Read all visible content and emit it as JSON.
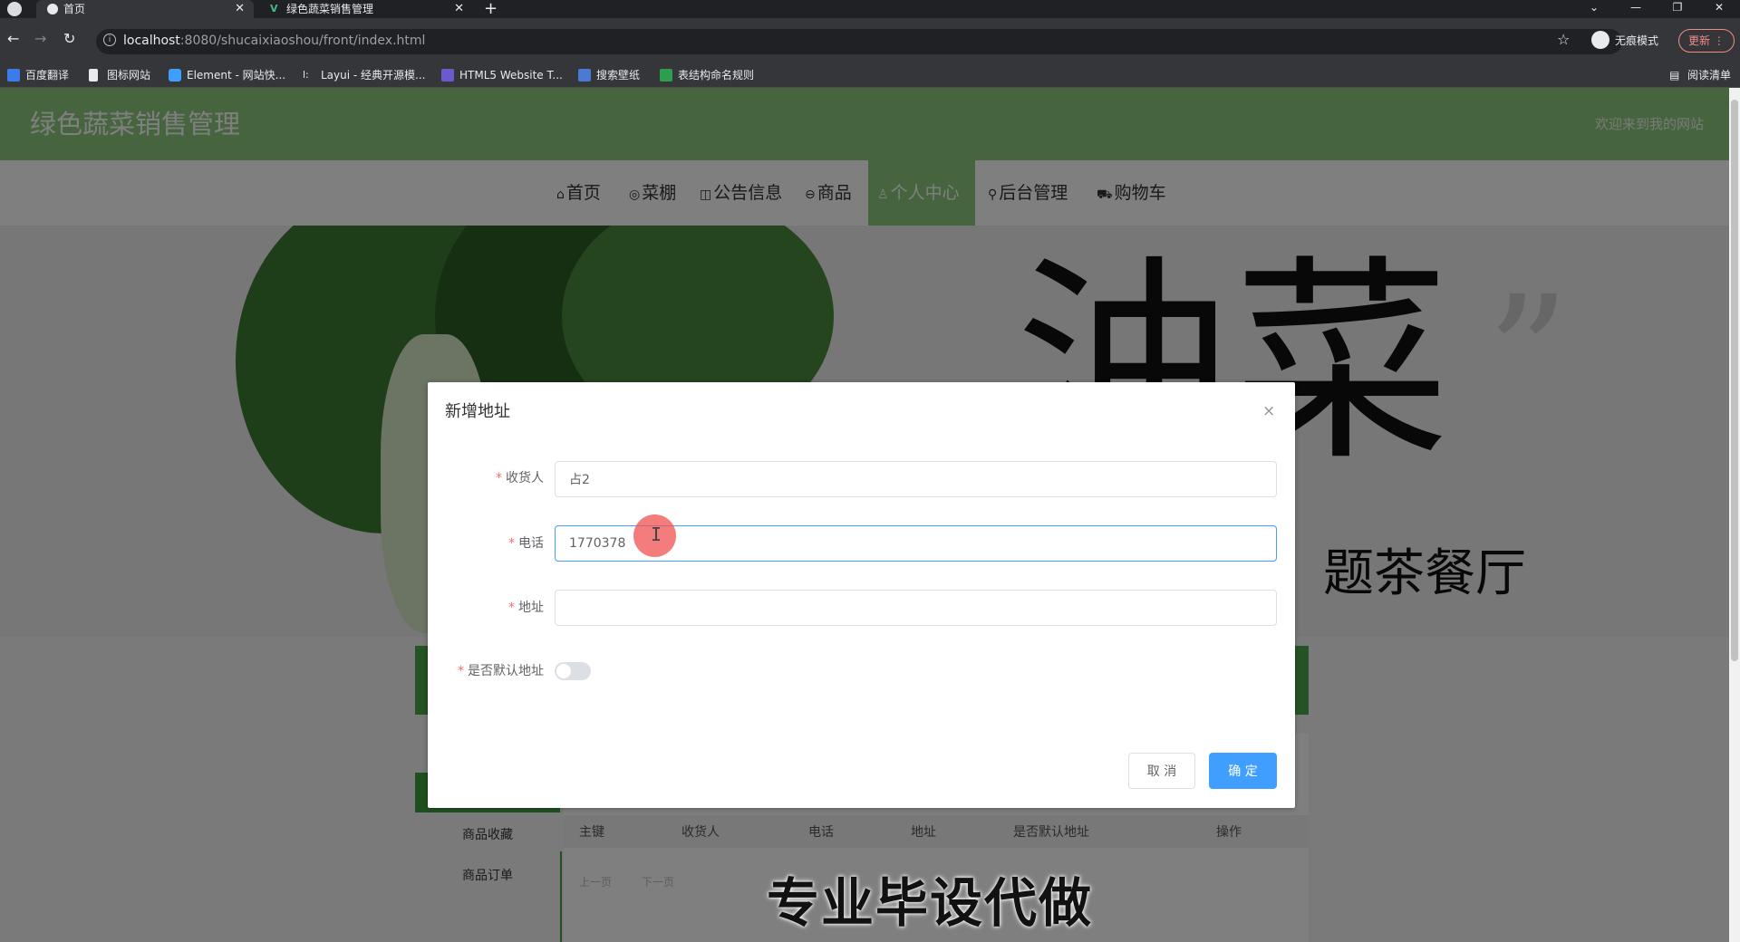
{
  "browser": {
    "tabs": [
      {
        "title": "首页",
        "active": true
      },
      {
        "title": "绿色蔬菜销售管理",
        "active": false
      }
    ],
    "new_tab": "+",
    "url_host": "localhost",
    "url_rest": ":8080/shucaixiaoshou/front/index.html",
    "incognito_label": "无痕模式",
    "update_label": "更新",
    "reading_list": "阅读清单",
    "bookmarks": [
      {
        "label": "百度翻译",
        "color": "#3b7bea"
      },
      {
        "label": "图标网站",
        "color": "#e8eaed"
      },
      {
        "label": "Element - 网站快...",
        "color": "#409eff"
      },
      {
        "label": "Layui - 经典开源模...",
        "color": "#e8eaed"
      },
      {
        "label": "HTML5 Website T...",
        "color": "#6a5acd"
      },
      {
        "label": "搜索壁纸",
        "color": "#4a7bd0"
      },
      {
        "label": "表结构命名规则",
        "color": "#2e9e4e"
      }
    ]
  },
  "site": {
    "title": "绿色蔬菜销售管理",
    "welcome": "欢迎来到我的网站",
    "accent": "#8dcb7e",
    "nav": [
      {
        "label": "首页",
        "icon": "⌂",
        "icon_name": "home-icon"
      },
      {
        "label": "菜棚",
        "icon": "◎",
        "icon_name": "greenhouse-icon"
      },
      {
        "label": "公告信息",
        "icon": "◫",
        "icon_name": "notice-icon"
      },
      {
        "label": "商品",
        "icon": "⊖",
        "icon_name": "goods-icon"
      },
      {
        "label": "个人中心",
        "icon": "♙",
        "icon_name": "user-icon",
        "active": true
      },
      {
        "label": "后台管理",
        "icon": "⚲",
        "icon_name": "link-icon"
      },
      {
        "label": "购物车",
        "icon": "⛟",
        "icon_name": "cart-icon"
      }
    ],
    "banner_text": "油菜",
    "banner_sub": "题茶餐厅"
  },
  "background_page": {
    "sidebar": [
      "商品收藏",
      "商品订单"
    ],
    "table_headers": [
      "主键",
      "收货人",
      "电话",
      "地址",
      "是否默认地址",
      "操作"
    ],
    "pager": [
      "上一页",
      "下一页"
    ]
  },
  "dialog": {
    "title": "新增地址",
    "close": "×",
    "fields": {
      "consignee": {
        "label": "收货人",
        "value": "占2"
      },
      "phone": {
        "label": "电话",
        "value": "1770378"
      },
      "address": {
        "label": "地址",
        "value": ""
      },
      "is_default": {
        "label": "是否默认地址",
        "value": false
      }
    },
    "cancel": "取 消",
    "confirm": "确 定",
    "primary_color": "#409eff"
  },
  "overlay_caption": "专业毕设代做"
}
